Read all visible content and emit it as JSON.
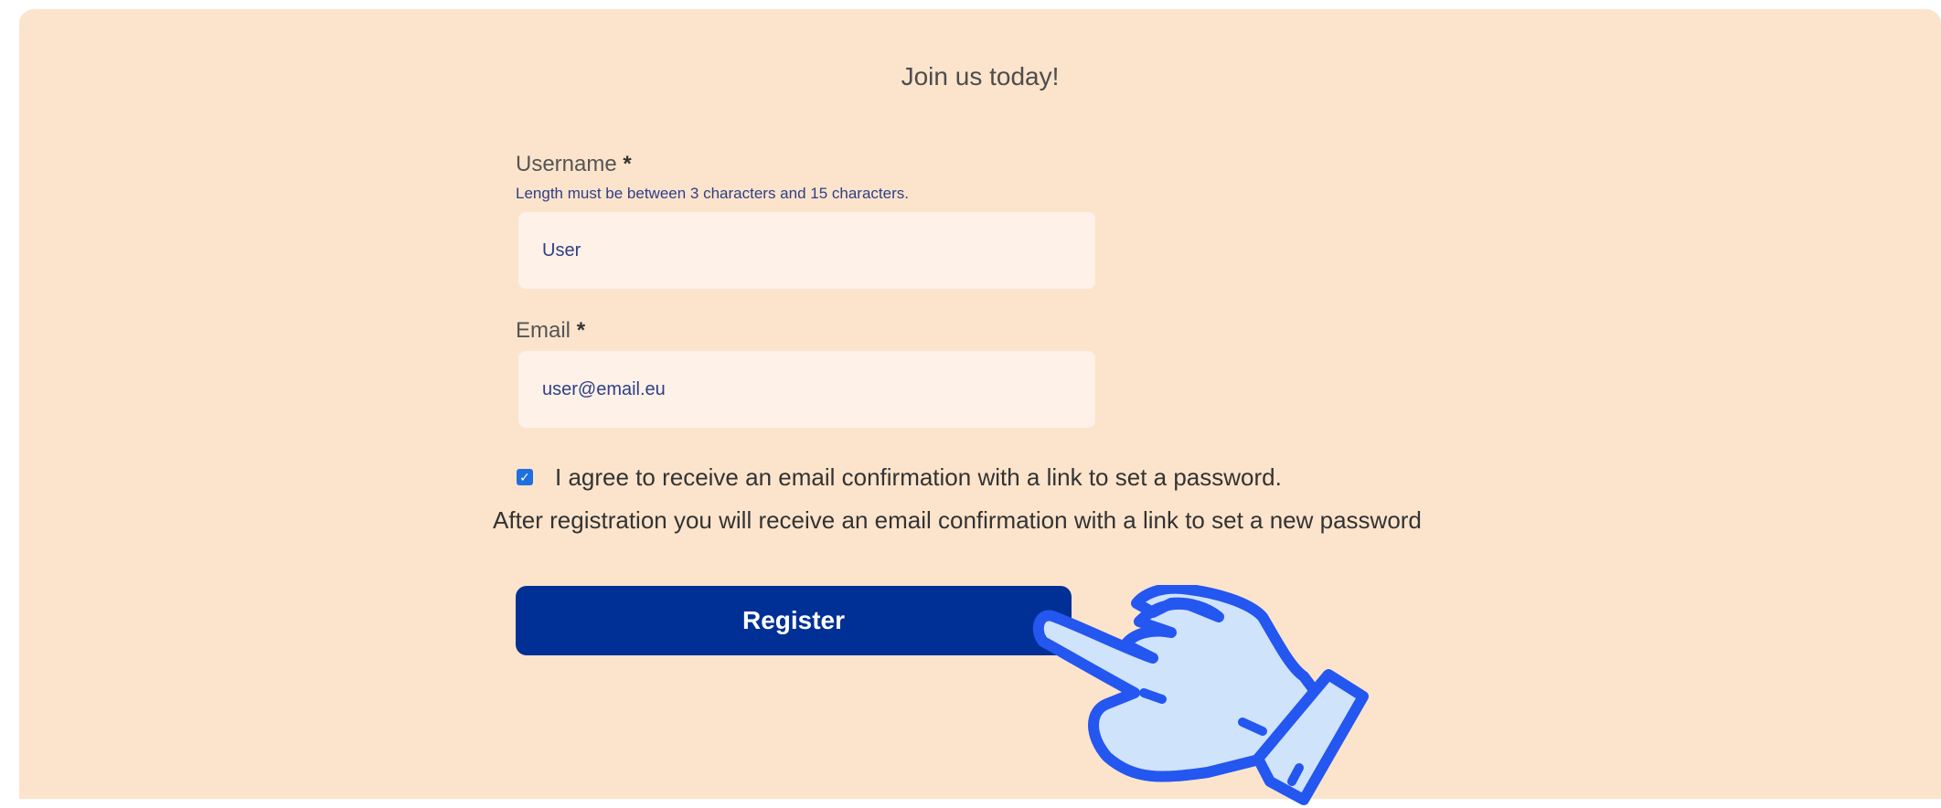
{
  "form": {
    "title": "Join us today!",
    "username": {
      "label": "Username",
      "required_mark": "*",
      "hint": "Length must be between 3 characters and 15 characters.",
      "value": "User"
    },
    "email": {
      "label": "Email",
      "required_mark": "*",
      "value": "user@email.eu"
    },
    "agree": {
      "checked": true,
      "label": "I agree to receive an email confirmation with a link to set a password."
    },
    "info_text": "After registration you will receive an email confirmation with a link to set a new password",
    "register_label": "Register"
  },
  "icons": {
    "pointer": "pointing-hand-icon"
  },
  "colors": {
    "panel_background": "#fce4cc",
    "input_background": "#fdf1e8",
    "button": "#003095",
    "hand_outline": "#2456f0",
    "hand_fill": "#cfe3fb"
  }
}
